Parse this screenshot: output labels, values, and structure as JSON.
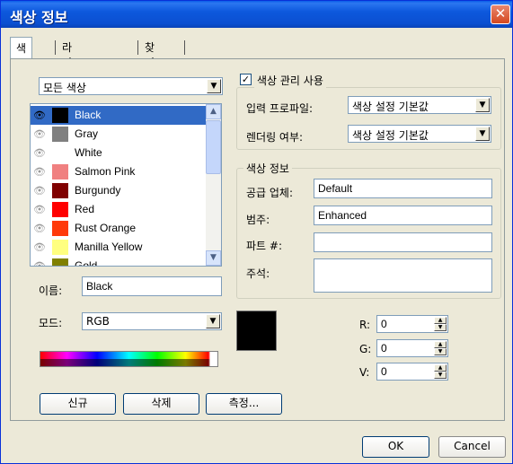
{
  "window": {
    "title": "색상 정보"
  },
  "tabs": [
    "색상",
    "라이브러리",
    "찾기"
  ],
  "filter": {
    "selected": "모든 색상"
  },
  "colors": [
    {
      "name": "Black",
      "hex": "#000000",
      "selected": true
    },
    {
      "name": "Gray",
      "hex": "#808080"
    },
    {
      "name": "White",
      "hex": "#ffffff"
    },
    {
      "name": "Salmon Pink",
      "hex": "#f08080"
    },
    {
      "name": "Burgundy",
      "hex": "#800000"
    },
    {
      "name": "Red",
      "hex": "#ff0000"
    },
    {
      "name": "Rust Orange",
      "hex": "#ff3a0a"
    },
    {
      "name": "Manilla Yellow",
      "hex": "#ffff80"
    },
    {
      "name": "Gold",
      "hex": "#808000"
    }
  ],
  "name_field": {
    "label": "이름:",
    "value": "Black"
  },
  "mode": {
    "label": "모드:",
    "value": "RGB"
  },
  "color_management": {
    "checkbox_label": "색상 관리 사용",
    "checked": true,
    "input_profile_label": "입력 프로파일:",
    "input_profile_value": "색상 설정 기본값",
    "rendering_label": "렌더링 여부:",
    "rendering_value": "색상 설정 기본값"
  },
  "color_info": {
    "title": "색상 정보",
    "supplier_label": "공급 업체:",
    "supplier_value": "Default",
    "category_label": "범주:",
    "category_value": "Enhanced",
    "part_label": "파트 #:",
    "part_value": "",
    "notes_label": "주석:",
    "notes_value": ""
  },
  "components": [
    {
      "label": "R:",
      "value": "0"
    },
    {
      "label": "G:",
      "value": "0"
    },
    {
      "label": "V:",
      "value": "0"
    }
  ],
  "buttons": {
    "new": "신규",
    "delete": "삭제",
    "measure": "측정...",
    "ok": "OK",
    "cancel": "Cancel"
  },
  "icons": {
    "visibility": "eye-icon",
    "dropdown": "chevron-down-icon",
    "close": "close-icon"
  },
  "colors_ui": {
    "selection": "#316ac5",
    "title_bar": "#0b4fd0",
    "dialog_bg": "#ece9d8"
  }
}
